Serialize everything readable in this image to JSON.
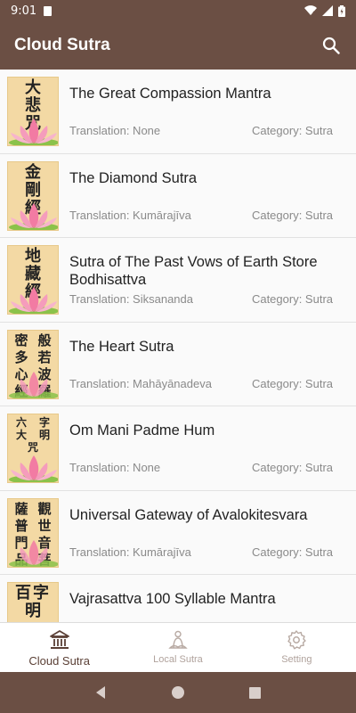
{
  "status": {
    "time": "9:01"
  },
  "app": {
    "title": "Cloud Sutra"
  },
  "sutras": [
    {
      "title": "The Great Compassion Mantra",
      "translation": "Translation: None",
      "category": "Category: Sutra",
      "thumb": [
        "大",
        "悲",
        "咒"
      ]
    },
    {
      "title": "The Diamond Sutra",
      "translation": "Translation: Kumārajīva",
      "category": "Category: Sutra",
      "thumb": [
        "金",
        "剛",
        "經"
      ]
    },
    {
      "title": "Sutra of The Past Vows of Earth Store Bodhisattva",
      "translation": "Translation: Siksananda",
      "category": "Category: Sutra",
      "thumb": [
        "地",
        "藏",
        "經"
      ]
    },
    {
      "title": "The Heart Sutra",
      "translation": "Translation: Mahāyānadeva",
      "category": "Category: Sutra",
      "thumb": [
        "密",
        "般",
        "多",
        "若",
        "心",
        "波",
        "經",
        "羅"
      ]
    },
    {
      "title": "Om Mani Padme Hum",
      "translation": "Translation: None",
      "category": "Category: Sutra",
      "thumb": [
        "六",
        "字",
        "大",
        "明",
        "咒"
      ]
    },
    {
      "title": "Universal Gateway of Avalokitesvara",
      "translation": "Translation: Kumārajīva",
      "category": "Category: Sutra",
      "thumb": [
        "薩",
        "觀",
        "普",
        "世",
        "門",
        "音",
        "品",
        "菩"
      ]
    },
    {
      "title": "Vajrasattva 100 Syllable Mantra",
      "translation": "",
      "category": "",
      "thumb": [
        "百",
        "字",
        "明"
      ]
    }
  ],
  "nav": {
    "cloud_label": "Cloud Sutra",
    "local_label": "Local Sutra",
    "setting_label": "Setting"
  },
  "colors": {
    "primary": "#6b4f44",
    "thumb_bg": "#f3d9a4"
  },
  "icons": [
    "sd-card-icon",
    "wifi-icon",
    "signal-icon",
    "battery-icon",
    "search-icon",
    "temple-icon",
    "buddha-icon",
    "gear-icon",
    "back-icon",
    "home-icon",
    "recents-icon"
  ]
}
